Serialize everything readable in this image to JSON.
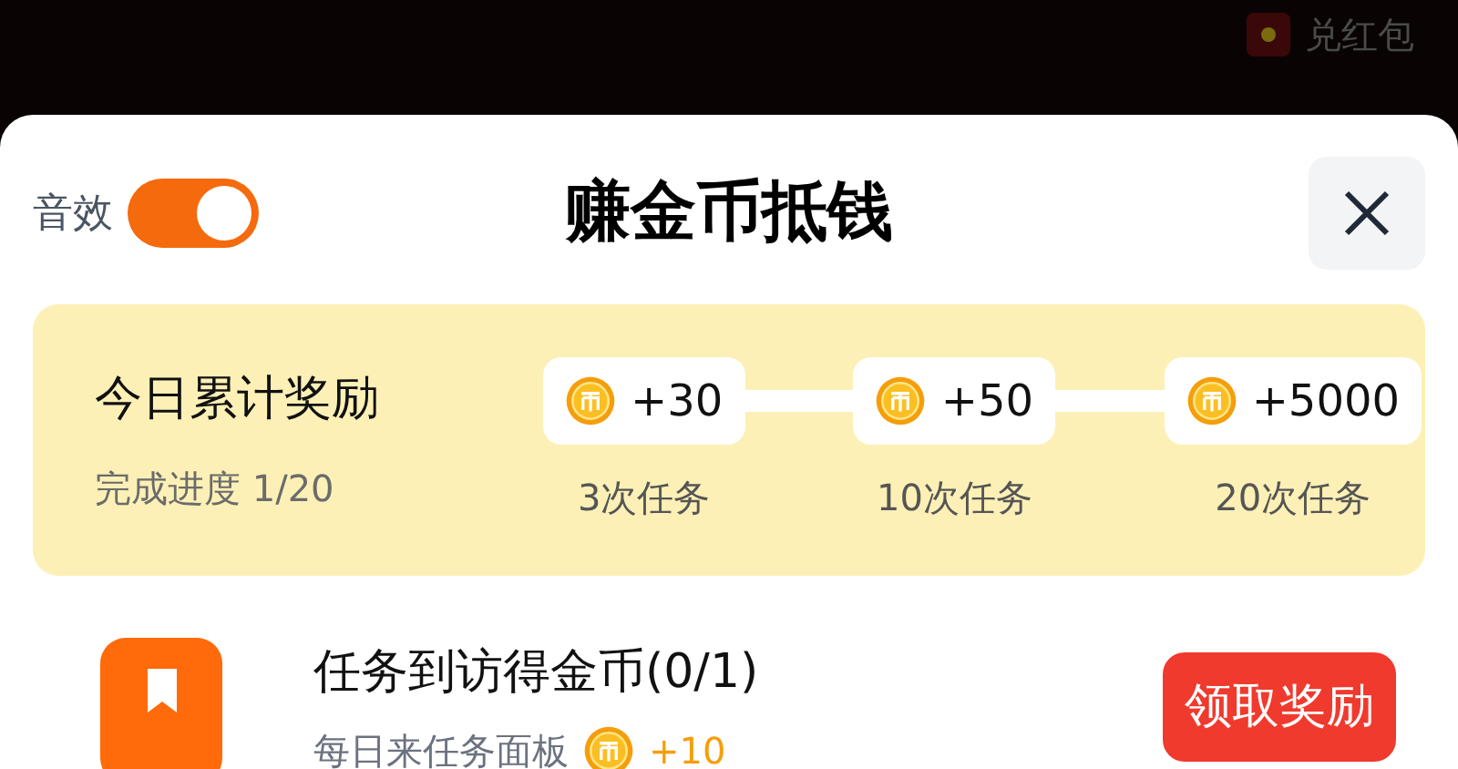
{
  "background": {
    "badge": "兑红包"
  },
  "header": {
    "sound_label": "音效",
    "sound_on": true,
    "title": "赚金币抵钱"
  },
  "daily_reward": {
    "title": "今日累计奖励",
    "progress": "完成进度 1/20",
    "milestones": [
      {
        "amount": "+30",
        "label": "3次任务"
      },
      {
        "amount": "+50",
        "label": "10次任务"
      },
      {
        "amount": "+5000",
        "label": "20次任务"
      }
    ]
  },
  "tasks": [
    {
      "title": "任务到访得金币(0/1)",
      "subtitle": "每日来任务面板",
      "reward": "+10",
      "button": "领取奖励"
    }
  ]
}
